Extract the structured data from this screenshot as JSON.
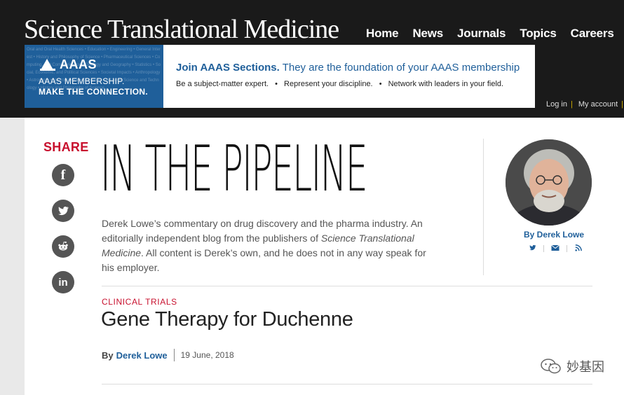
{
  "header": {
    "brand": "Science Translational Medicine",
    "nav": [
      "Home",
      "News",
      "Journals",
      "Topics",
      "Careers"
    ],
    "account": [
      "Log in",
      "My account"
    ]
  },
  "banner": {
    "logo": "AAAS",
    "sub1": "AAAS MEMBERSHIP.",
    "sub2": "MAKE THE CONNECTION.",
    "noise": "Oral and Oral Health Sciences • Education • Engineering • General Interest • History and Philosophy of Science • Pharmaceutical Sciences • Computing, and Communication • Geology and Geography • Statistics • Social, Economic, and Political Sciences • Societal Impacts • Anthropology • Astronomy • Neuroscience • Chemistry • Industrial Science and Technology • History and Philosophy of Science",
    "head_bold": "Join AAAS Sections.",
    "head_rest": " They are the foundation of your AAAS membership",
    "points": [
      "Be a subject-matter expert.",
      "Represent your discipline.",
      "Network with leaders in your field."
    ],
    "bullet": "•"
  },
  "share": {
    "label": "SHARE",
    "icons": [
      "facebook-icon",
      "twitter-icon",
      "reddit-icon",
      "linkedin-icon"
    ],
    "fb_glyph": "f",
    "in_glyph": "in"
  },
  "blog": {
    "title": "IN THE PIPELINE",
    "desc_a": "Derek Lowe’s commentary on drug discovery and the pharma industry. An editorially independent blog from the publishers of ",
    "desc_italic": "Science Translational Medicine",
    "desc_b": ". All content is Derek’s own, and he does not in any way speak for his employer."
  },
  "author": {
    "by": "By Derek Lowe",
    "links": [
      "twitter-icon",
      "email-icon",
      "rss-icon"
    ]
  },
  "post": {
    "category": "CLINICAL TRIALS",
    "title": "Gene Therapy for Duchenne",
    "by_prefix": "By",
    "author": "Derek Lowe",
    "date": "19 June, 2018"
  },
  "watermark": {
    "text": "妙基因"
  },
  "colors": {
    "accent_red": "#c8102e",
    "link_blue": "#1f5f9a",
    "header_bg": "#1a1a1a",
    "icon_grey": "#555555"
  }
}
